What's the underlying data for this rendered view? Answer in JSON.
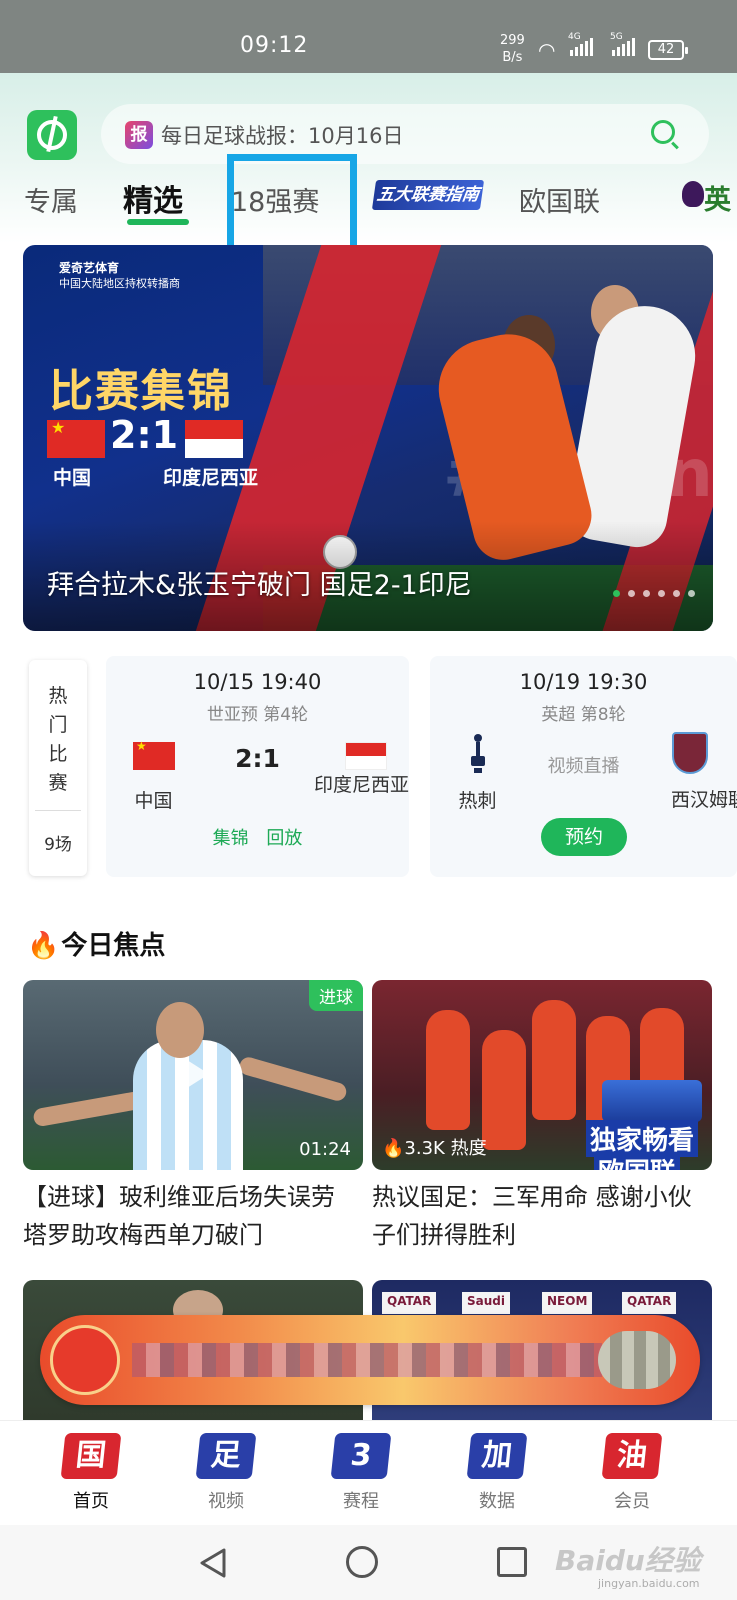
{
  "status_bar": {
    "time": "09:12",
    "net_speed_value": "299",
    "net_speed_unit": "B/s",
    "net1": "4G",
    "net2": "5G",
    "battery": "42"
  },
  "app": {
    "brand_color": "#2ec05c",
    "accent_blue": "#17a6e6"
  },
  "search": {
    "badge": "报",
    "text": "每日足球战报：10月16日",
    "icon": "search-icon"
  },
  "tabs": [
    {
      "label": "专属"
    },
    {
      "label": "精选",
      "active": true
    },
    {
      "label": "18强赛",
      "highlighted": true
    },
    {
      "label": "五大联赛指南"
    },
    {
      "label": "欧国联"
    },
    {
      "label": "英超"
    }
  ],
  "banner": {
    "brand_title": "爱奇艺体育",
    "brand_sub": "中国大陆地区持权转播商",
    "headline": "比赛集锦",
    "score": "2:1",
    "team_home": "中国",
    "team_away": "印度尼西亚",
    "caption": "拜合拉木&张玉宁破门 国足2-1印尼",
    "watermark": "#Asian Quali",
    "slides": 6,
    "current_slide": 0
  },
  "hot": {
    "label_chars": [
      "热",
      "门",
      "比",
      "赛"
    ],
    "count": "9场"
  },
  "matches": [
    {
      "time": "10/15 19:40",
      "league": "世亚预 第4轮",
      "home": "中国",
      "away": "印度尼西亚",
      "score": "2:1",
      "actions": [
        "集锦",
        "回放"
      ]
    },
    {
      "time": "10/19 19:30",
      "league": "英超 第8轮",
      "home": "热刺",
      "away": "西汉姆联",
      "status": "视频直播",
      "button": "预约"
    }
  ],
  "focus": {
    "title": "今日焦点",
    "items": [
      {
        "tag": "进球",
        "duration": "01:24",
        "title": "【进球】玻利维亚后场失误劳塔罗助攻梅西单刀破门"
      },
      {
        "heat": "3.3K 热度",
        "promo_line1": "独家畅看",
        "promo_line2": "欧国联",
        "title": "热议国足：三军用命 感谢小伙子们拼得胜利"
      }
    ]
  },
  "lower_ads": [
    "QATAR",
    "Saudi",
    "NEOM",
    "QATAR"
  ],
  "bottom_nav": [
    {
      "glyph": "国",
      "label": "首页",
      "active": true,
      "color": "#d8262f"
    },
    {
      "glyph": "足",
      "label": "视频",
      "color": "#2a3fa8"
    },
    {
      "glyph": "3",
      "label": "赛程",
      "color": "#2a3fa8"
    },
    {
      "glyph": "加",
      "label": "数据",
      "color": "#2a3fa8"
    },
    {
      "glyph": "油",
      "label": "会员",
      "color": "#d8262f"
    }
  ],
  "watermark": {
    "main": "Baidu经验",
    "sub": "jingyan.baidu.com"
  }
}
